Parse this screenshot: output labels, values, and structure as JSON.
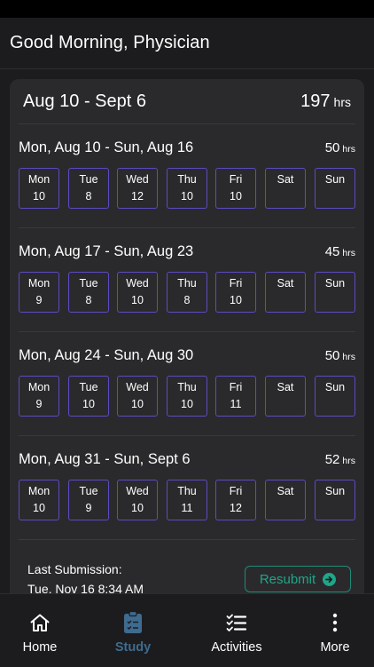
{
  "header": {
    "greeting": "Good Morning, Physician"
  },
  "summary": {
    "range": "Aug 10 - Sept 6",
    "total": "197",
    "unit": "hrs"
  },
  "weeks": [
    {
      "range": "Mon, Aug 10 - Sun, Aug 16",
      "hours": "50",
      "unit": "hrs",
      "days": [
        {
          "name": "Mon",
          "value": "10"
        },
        {
          "name": "Tue",
          "value": "8"
        },
        {
          "name": "Wed",
          "value": "12"
        },
        {
          "name": "Thu",
          "value": "10"
        },
        {
          "name": "Fri",
          "value": "10"
        },
        {
          "name": "Sat",
          "value": ""
        },
        {
          "name": "Sun",
          "value": ""
        }
      ]
    },
    {
      "range": "Mon, Aug 17 - Sun, Aug 23",
      "hours": "45",
      "unit": "hrs",
      "days": [
        {
          "name": "Mon",
          "value": "9"
        },
        {
          "name": "Tue",
          "value": "8"
        },
        {
          "name": "Wed",
          "value": "10"
        },
        {
          "name": "Thu",
          "value": "8"
        },
        {
          "name": "Fri",
          "value": "10"
        },
        {
          "name": "Sat",
          "value": ""
        },
        {
          "name": "Sun",
          "value": ""
        }
      ]
    },
    {
      "range": "Mon, Aug 24 - Sun, Aug 30",
      "hours": "50",
      "unit": "hrs",
      "days": [
        {
          "name": "Mon",
          "value": "9"
        },
        {
          "name": "Tue",
          "value": "10"
        },
        {
          "name": "Wed",
          "value": "10"
        },
        {
          "name": "Thu",
          "value": "10"
        },
        {
          "name": "Fri",
          "value": "11"
        },
        {
          "name": "Sat",
          "value": ""
        },
        {
          "name": "Sun",
          "value": ""
        }
      ]
    },
    {
      "range": "Mon, Aug 31 - Sun, Sept 6",
      "hours": "52",
      "unit": "hrs",
      "days": [
        {
          "name": "Mon",
          "value": "10"
        },
        {
          "name": "Tue",
          "value": "9"
        },
        {
          "name": "Wed",
          "value": "10"
        },
        {
          "name": "Thu",
          "value": "11"
        },
        {
          "name": "Fri",
          "value": "12"
        },
        {
          "name": "Sat",
          "value": ""
        },
        {
          "name": "Sun",
          "value": ""
        }
      ]
    }
  ],
  "submission": {
    "label": "Last Submission:",
    "time": "Tue, Nov 16 8:34 AM",
    "button": "Resubmit"
  },
  "tabs": [
    {
      "label": "Home",
      "icon": "home-icon"
    },
    {
      "label": "Study",
      "icon": "clipboard-icon"
    },
    {
      "label": "Activities",
      "icon": "checklist-icon"
    },
    {
      "label": "More",
      "icon": "more-vertical-icon"
    }
  ],
  "colors": {
    "accent_day_border": "#5b4bc4",
    "resubmit": "#1fa68a",
    "active_tab": "#3e6b8f"
  }
}
